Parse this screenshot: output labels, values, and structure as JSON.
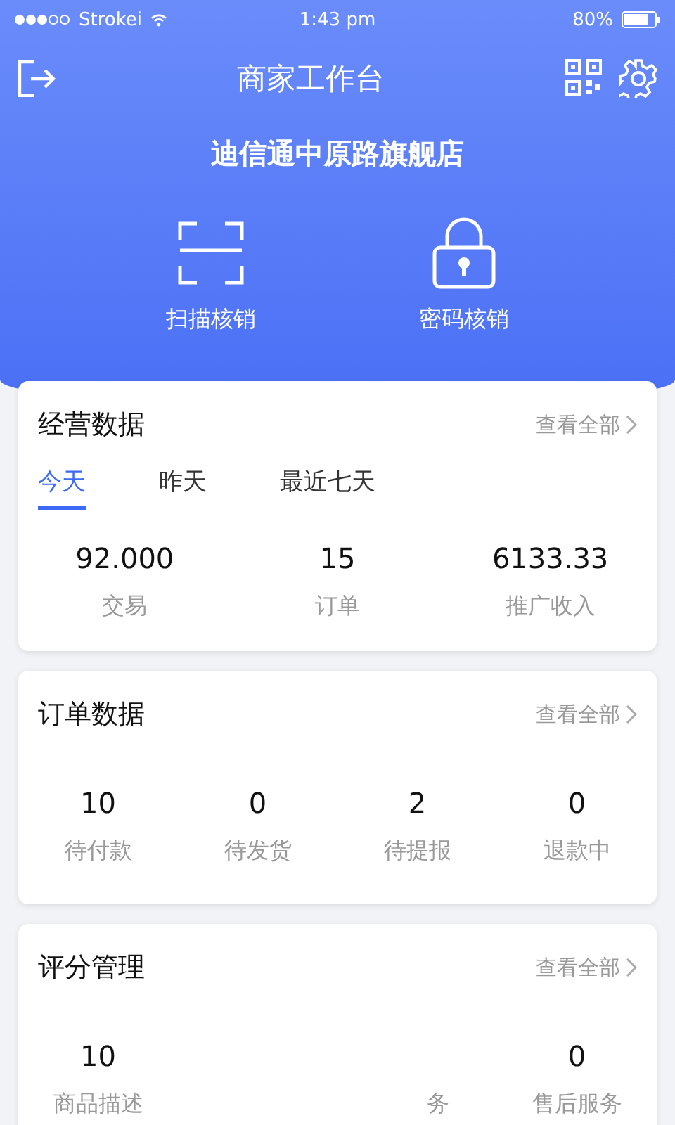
{
  "status_bar": {
    "carrier": "Strokei",
    "time": "1:43 pm",
    "battery": "80%"
  },
  "header": {
    "title": "商家工作台",
    "store_name": "迪信通中原路旗舰店"
  },
  "actions": [
    {
      "kind": "scan",
      "label": "扫描核销"
    },
    {
      "kind": "lock",
      "label": "密码核销"
    }
  ],
  "business_card": {
    "title": "经营数据",
    "link": "查看全部",
    "tabs": [
      {
        "label": "今天",
        "selected": true
      },
      {
        "label": "昨天",
        "selected": false
      },
      {
        "label": "最近七天",
        "selected": false
      }
    ],
    "stats": [
      {
        "value": "92.000",
        "label": "交易"
      },
      {
        "value": "15",
        "label": "订单"
      },
      {
        "value": "6133.33",
        "label": "推广收入"
      }
    ]
  },
  "order_card": {
    "title": "订单数据",
    "link": "查看全部",
    "stats": [
      {
        "value": "10",
        "label": "待付款"
      },
      {
        "value": "0",
        "label": "待发货"
      },
      {
        "value": "2",
        "label": "待提报"
      },
      {
        "value": "0",
        "label": "退款中"
      }
    ]
  },
  "rating_card": {
    "title": "评分管理",
    "link": "查看全部",
    "stats": [
      {
        "kind": "stat",
        "value": "10",
        "label": "商品描述"
      },
      {
        "kind": "blank"
      },
      {
        "kind": "tail",
        "label": "务"
      },
      {
        "kind": "stat",
        "value": "0",
        "label": "售后服务"
      }
    ]
  }
}
